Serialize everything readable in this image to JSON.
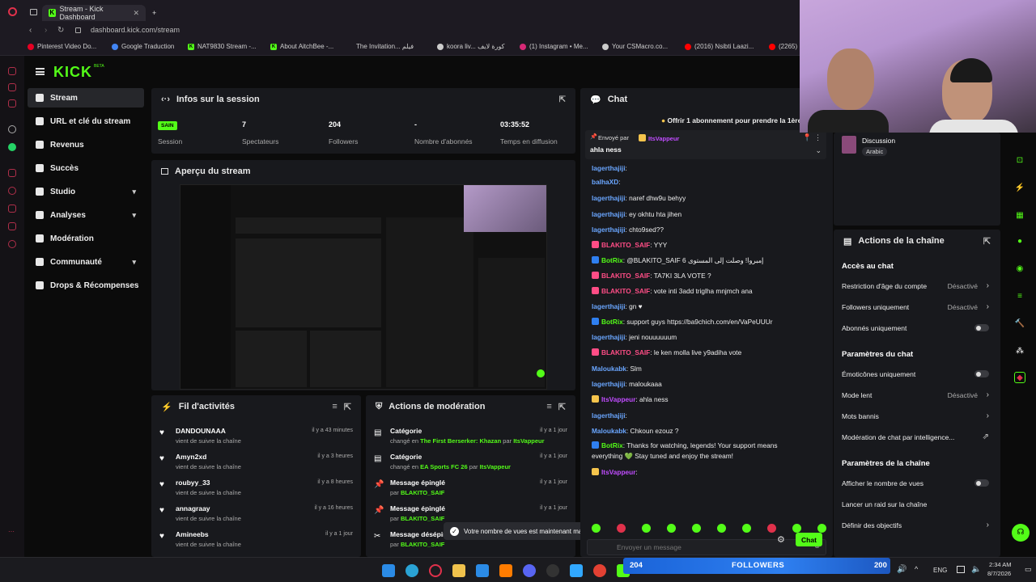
{
  "browser": {
    "tab_title": "Stream - Kick Dashboard",
    "new_tab": "+",
    "url": "dashboard.kick.com/stream",
    "bookmarks": [
      "Pinterest Video Do...",
      "Google Traduction",
      "NAT9830 Stream -...",
      "About AitchBee -...",
      "The Invitation... فيلم",
      "koora liv... كورة لايف",
      "(1) Instagram • Me...",
      "Your CSMacro.co...",
      "(2016) Nsibti Laazi...",
      "(2265)"
    ]
  },
  "logo": "KICK",
  "logo_beta": "BETA",
  "nav": [
    {
      "label": "Stream",
      "chev": ""
    },
    {
      "label": "URL et clé du stream",
      "chev": ""
    },
    {
      "label": "Revenus",
      "chev": ""
    },
    {
      "label": "Succès",
      "chev": ""
    },
    {
      "label": "Studio",
      "chev": "▾"
    },
    {
      "label": "Analyses",
      "chev": "▾"
    },
    {
      "label": "Modération",
      "chev": ""
    },
    {
      "label": "Communauté",
      "chev": "▾"
    },
    {
      "label": "Drops & Récompenses",
      "chev": ""
    }
  ],
  "session": {
    "title": "Infos sur la session",
    "badge": "SAIN",
    "badge_label": "Session",
    "stats": [
      {
        "value": "7",
        "label": "Spectateurs"
      },
      {
        "value": "204",
        "label": "Followers"
      },
      {
        "value": "-",
        "label": "Nombre d'abonnés"
      },
      {
        "value": "03:35:52",
        "label": "Temps en diffusion"
      }
    ]
  },
  "preview": {
    "title": "Aperçu du stream"
  },
  "activity": {
    "title": "Fil d'activités",
    "items": [
      {
        "name": "DANDOUNAAA",
        "sub": "vient de suivre la chaîne",
        "time": "il y a 43 minutes"
      },
      {
        "name": "Amyn2xd",
        "sub": "vient de suivre la chaîne",
        "time": "il y a 3 heures"
      },
      {
        "name": "roubyy_33",
        "sub": "vient de suivre la chaîne",
        "time": "il y a 8 heures"
      },
      {
        "name": "annagraay",
        "sub": "vient de suivre la chaîne",
        "time": "il y a 16 heures"
      },
      {
        "name": "Amineebs",
        "sub": "vient de suivre la chaîne",
        "time": "il y a 1 jour"
      }
    ]
  },
  "modactions": {
    "title": "Actions de modération",
    "items": [
      {
        "name": "Catégorie",
        "pre": "changé en ",
        "hl": "The First Berserker: Khazan",
        "mid": " par ",
        "by": "ItsVappeur",
        "time": "il y a 1 jour"
      },
      {
        "name": "Catégorie",
        "pre": "changé en ",
        "hl": "EA Sports FC 26",
        "mid": " par ",
        "by": "ItsVappeur",
        "time": "il y a 1 jour"
      },
      {
        "name": "Message épinglé",
        "pre": "par ",
        "hl": "",
        "mid": "",
        "by": "BLAKITO_SAIF",
        "time": "il y a 1 jour"
      },
      {
        "name": "Message épinglé",
        "pre": "par ",
        "hl": "",
        "mid": "",
        "by": "BLAKITO_SAIF",
        "time": "il y a 1 jour"
      },
      {
        "name": "Message désépin",
        "pre": "par ",
        "hl": "",
        "mid": "",
        "by": "BLAKITO_SAIF",
        "time": ""
      }
    ]
  },
  "toast": "Votre nombre de vues est maintenant masqué",
  "chat": {
    "title": "Chat",
    "gift_banner": "Offrir 1 abonnement pour prendre la 1ère",
    "pinned_sent_by": "Envoyé par",
    "pinned_user": "ItsVappeur",
    "pinned_msg": "ahla ness",
    "messages": [
      {
        "user": "lagerthajiji",
        "cls": "u-blue",
        "text": ": "
      },
      {
        "user": "balhaXD",
        "cls": "u-blue",
        "text": ": "
      },
      {
        "user": "lagerthajiji",
        "cls": "u-blue",
        "text": ": naref dhw9u behyy"
      },
      {
        "user": "lagerthajiji",
        "cls": "u-blue",
        "text": ": ey okhtu hta jihen"
      },
      {
        "user": "lagerthajiji",
        "cls": "u-blue",
        "text": ": chto9sed??"
      },
      {
        "user": "BLAKITO_SAIF",
        "cls": "u-pink",
        "text": ": YYY"
      },
      {
        "user": "BotRix",
        "cls": "u-green",
        "text": ": @BLAKITO_SAIF 6 إمبروا! وصلت إلى المستوى"
      },
      {
        "user": "BLAKITO_SAIF",
        "cls": "u-pink",
        "text": ": TA7KI 3LA VOTE ?"
      },
      {
        "user": "BLAKITO_SAIF",
        "cls": "u-pink",
        "text": ": vote inti 3add triglha mnjmch ana"
      },
      {
        "user": "lagerthajiji",
        "cls": "u-blue",
        "text": ": gn ♥"
      },
      {
        "user": "BotRix",
        "cls": "u-green",
        "text": ": support guys https://ba9chich.com/en/VaPeUUUr"
      },
      {
        "user": "lagerthajiji",
        "cls": "u-blue",
        "text": ": jeni nouuuuuum"
      },
      {
        "user": "BLAKITO_SAIF",
        "cls": "u-pink",
        "text": ": le ken molla live y9adiha vote"
      },
      {
        "user": "Maloukabk",
        "cls": "u-blue",
        "text": ": Slm"
      },
      {
        "user": "lagerthajiji",
        "cls": "u-blue",
        "text": ": maloukaaa"
      },
      {
        "user": "ItsVappeur",
        "cls": "u-purple",
        "text": ": ahla ness"
      },
      {
        "user": "lagerthajiji",
        "cls": "u-blue",
        "text": ": "
      },
      {
        "user": "Maloukabk",
        "cls": "u-blue",
        "text": ": Chkoun ezouz ?"
      },
      {
        "user": "BotRix",
        "cls": "u-green",
        "text": ": Thanks for watching, legends! Your support means"
      },
      {
        "user": "",
        "cls": "",
        "text": "everything 💚 Stay tuned and enjoy the stream!"
      },
      {
        "user": "ItsVappeur",
        "cls": "u-purple",
        "text": ": "
      }
    ],
    "input_placeholder": "Envoyer un message",
    "send_label": "Chat"
  },
  "discussion": {
    "title": "Discussion",
    "tag": "Arabic"
  },
  "channel_actions": {
    "title": "Actions de la chaîne",
    "sections": [
      {
        "head": "Accès au chat",
        "rows": [
          {
            "label": "Restriction d'âge du compte",
            "value": "Désactivé",
            "kind": "arrow"
          },
          {
            "label": "Followers uniquement",
            "value": "Désactivé",
            "kind": "arrow"
          },
          {
            "label": "Abonnés uniquement",
            "value": "",
            "kind": "toggle"
          }
        ]
      },
      {
        "head": "Paramètres du chat",
        "rows": [
          {
            "label": "Émoticônes uniquement",
            "value": "",
            "kind": "toggle"
          },
          {
            "label": "Mode lent",
            "value": "Désactivé",
            "kind": "arrow"
          },
          {
            "label": "Mots bannis",
            "value": "",
            "kind": "arrow"
          },
          {
            "label": "Modération de chat par intelligence...",
            "value": "",
            "kind": "ext"
          }
        ]
      },
      {
        "head": "Paramètres de la chaîne",
        "rows": [
          {
            "label": "Afficher le nombre de vues",
            "value": "",
            "kind": "toggle"
          },
          {
            "label": "Lancer un raid sur la chaîne",
            "value": "",
            "kind": ""
          },
          {
            "label": "Définir des objectifs",
            "value": "",
            "kind": "arrow"
          }
        ]
      }
    ]
  },
  "followers_bar": {
    "count": "204",
    "label": "FOLLOWERS",
    "goal": "200"
  },
  "tray": {
    "lang": "ENG",
    "time": "2:34 AM",
    "date": "8/7/2026"
  },
  "colors": {
    "brand": "#53fc18",
    "panel": "#18191d",
    "bg": "#0b0b0b"
  }
}
